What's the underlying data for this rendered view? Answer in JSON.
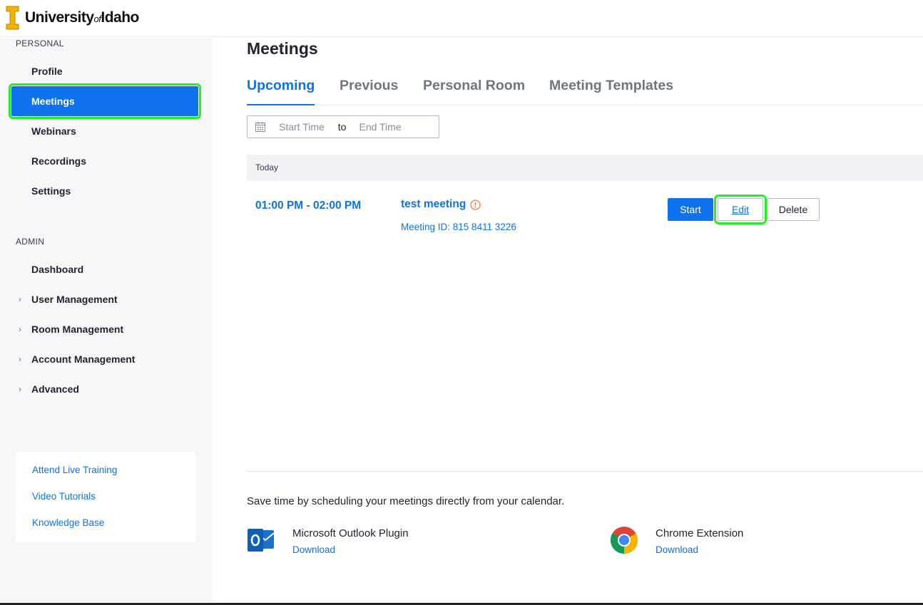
{
  "brand": {
    "logo_text": "University",
    "logo_of": "of",
    "logo_tail": "Idaho",
    "logo_color": "#f1b300"
  },
  "sidebar": {
    "personal_label": "PERSONAL",
    "personal_items": [
      {
        "label": "Profile"
      },
      {
        "label": "Meetings",
        "active": true
      },
      {
        "label": "Webinars"
      },
      {
        "label": "Recordings"
      },
      {
        "label": "Settings"
      }
    ],
    "admin_label": "ADMIN",
    "admin_items": [
      {
        "label": "Dashboard"
      },
      {
        "label": "User Management",
        "expandable": true
      },
      {
        "label": "Room Management",
        "expandable": true
      },
      {
        "label": "Account Management",
        "expandable": true
      },
      {
        "label": "Advanced",
        "expandable": true
      }
    ],
    "help_links": [
      {
        "label": "Attend Live Training"
      },
      {
        "label": "Video Tutorials"
      },
      {
        "label": "Knowledge Base"
      }
    ]
  },
  "main": {
    "title": "Meetings",
    "tabs": [
      {
        "label": "Upcoming",
        "active": true
      },
      {
        "label": "Previous"
      },
      {
        "label": "Personal Room"
      },
      {
        "label": "Meeting Templates"
      }
    ],
    "date_filter": {
      "start_placeholder": "Start Time",
      "separator": "to",
      "end_placeholder": "End Time"
    },
    "day_label": "Today",
    "meeting": {
      "time": "01:00 PM - 02:00 PM",
      "topic": "test meeting",
      "meeting_id": "Meeting ID: 815 8411 3226",
      "start_label": "Start",
      "edit_label": "Edit",
      "delete_label": "Delete"
    },
    "calendar_promo": "Save time by scheduling your meetings directly from your calendar.",
    "plugins": [
      {
        "name": "Microsoft Outlook Plugin",
        "link": "Download",
        "icon": "outlook-icon"
      },
      {
        "name": "Chrome Extension",
        "link": "Download",
        "icon": "chrome-icon"
      }
    ]
  },
  "colors": {
    "accent": "#0e72ed",
    "highlight": "#22ee22",
    "warning": "#e8733b"
  }
}
